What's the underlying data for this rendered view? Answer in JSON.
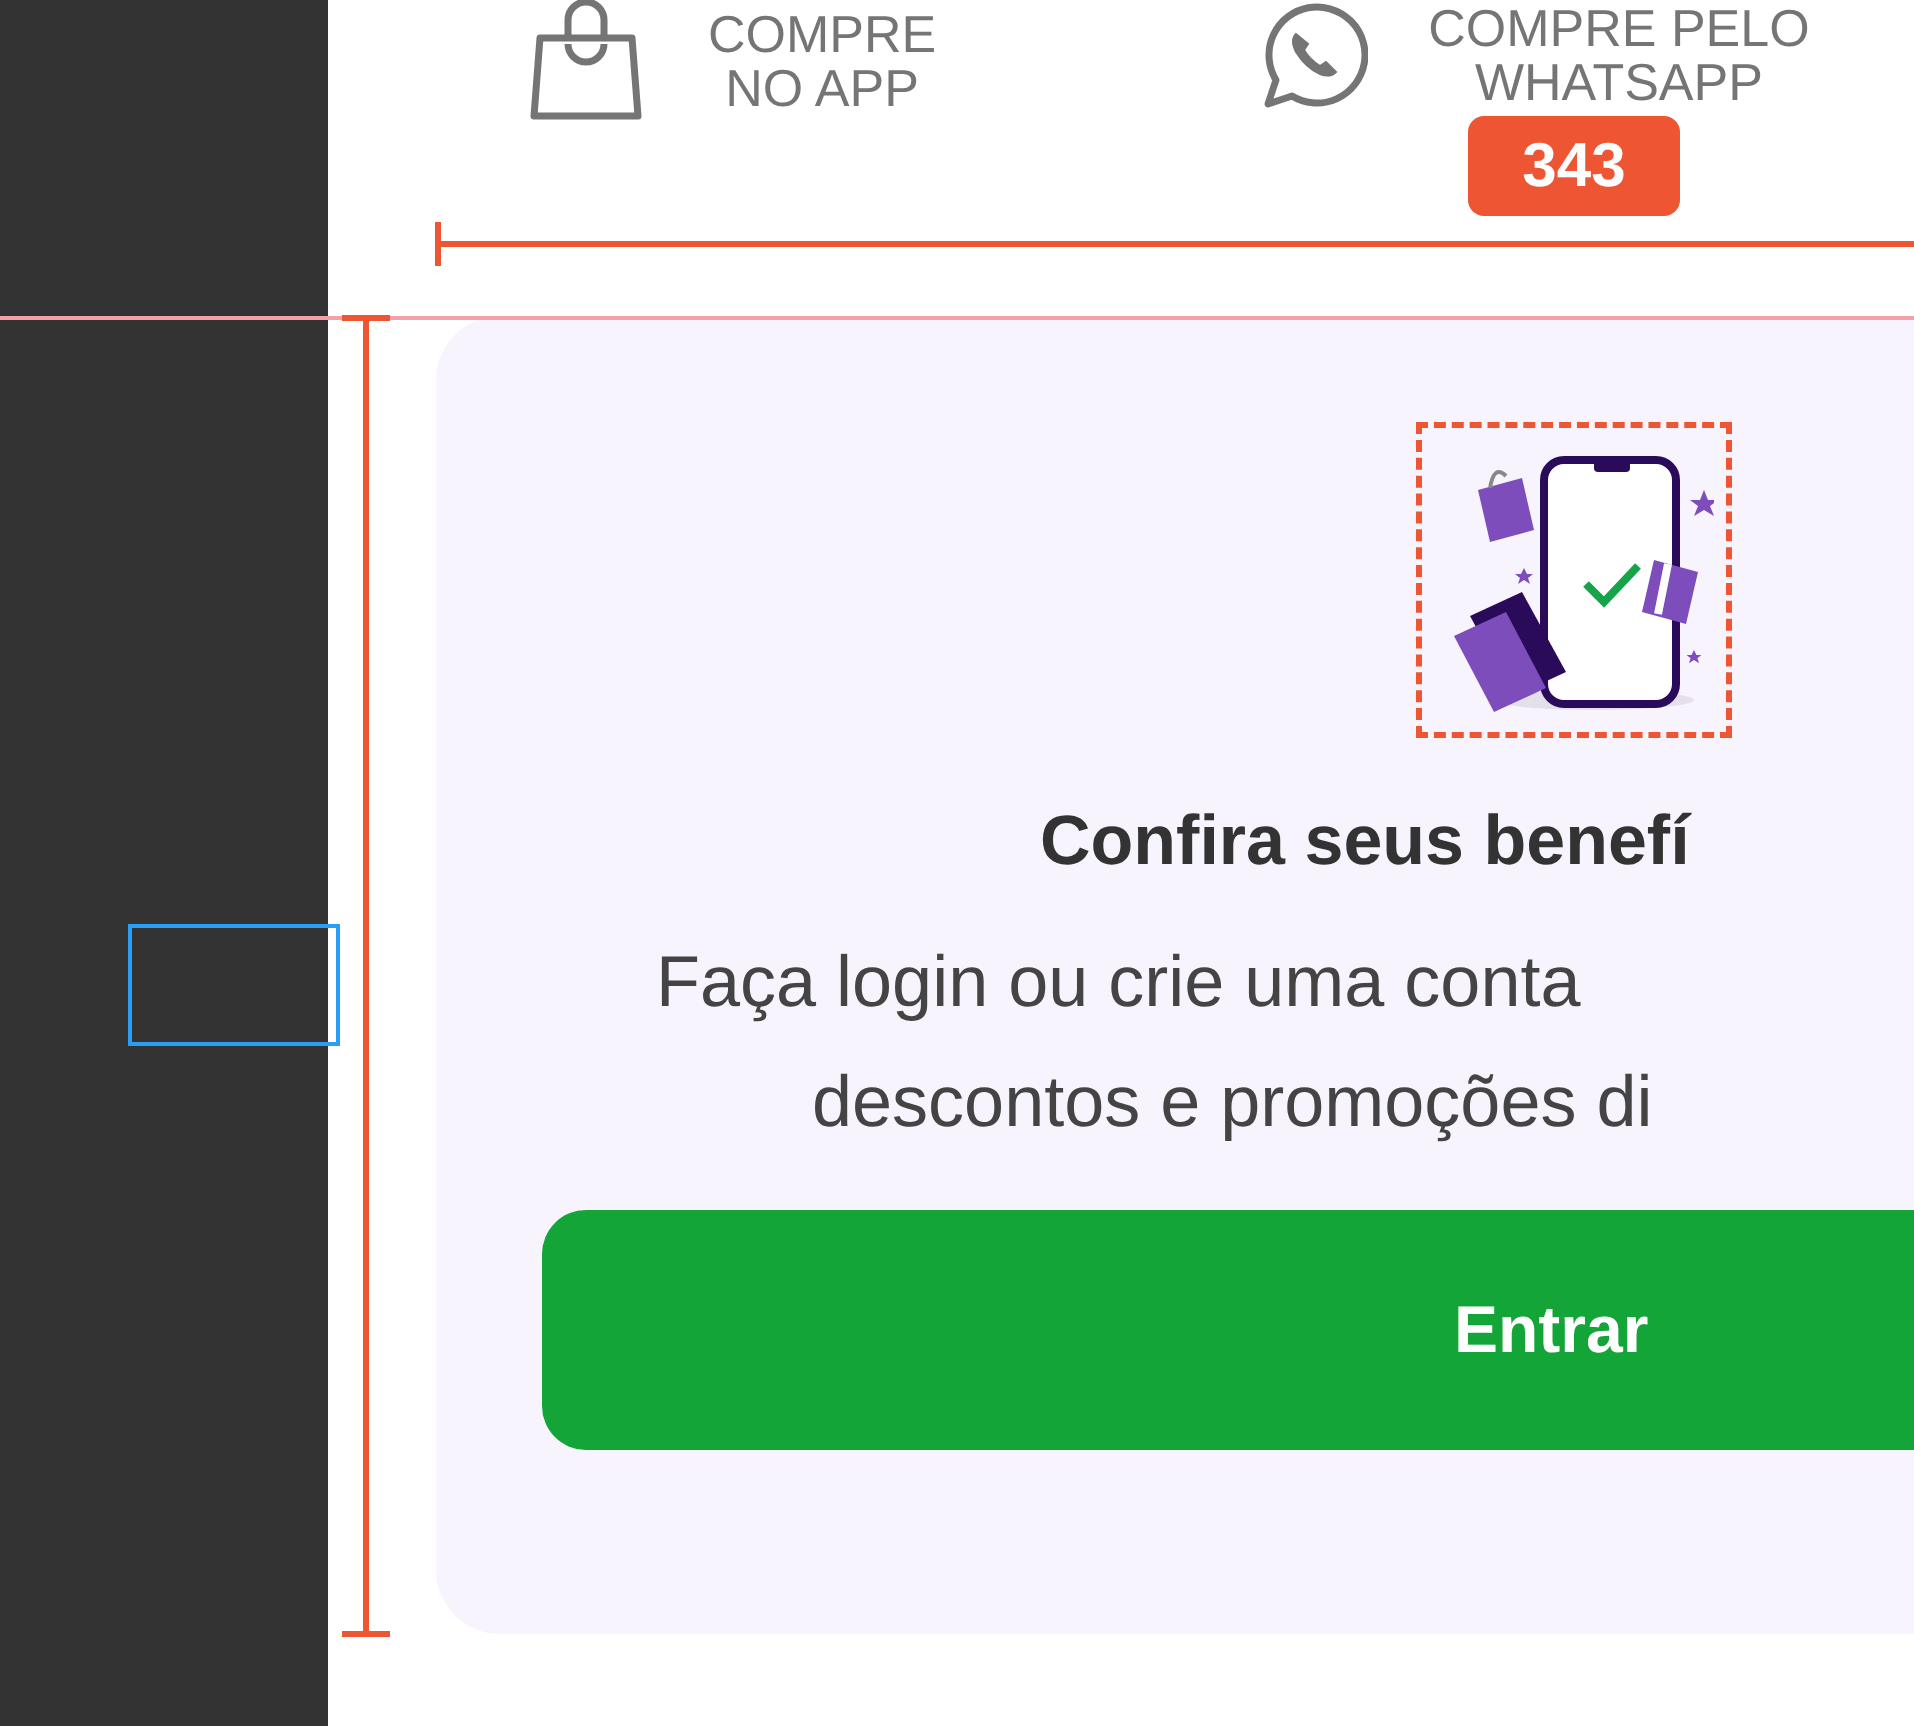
{
  "top_links": [
    {
      "kind": "bag",
      "lines": [
        "COMPRE",
        "NO APP"
      ]
    },
    {
      "kind": "whatsapp",
      "lines": [
        "COMPRE PELO",
        "WHATSAPP"
      ]
    }
  ],
  "measurement": {
    "label": "343"
  },
  "card": {
    "title": "Confira seus benefí",
    "description": [
      "Faça login ou crie uma conta",
      "descontos e promoções di"
    ],
    "button": "Entrar"
  }
}
